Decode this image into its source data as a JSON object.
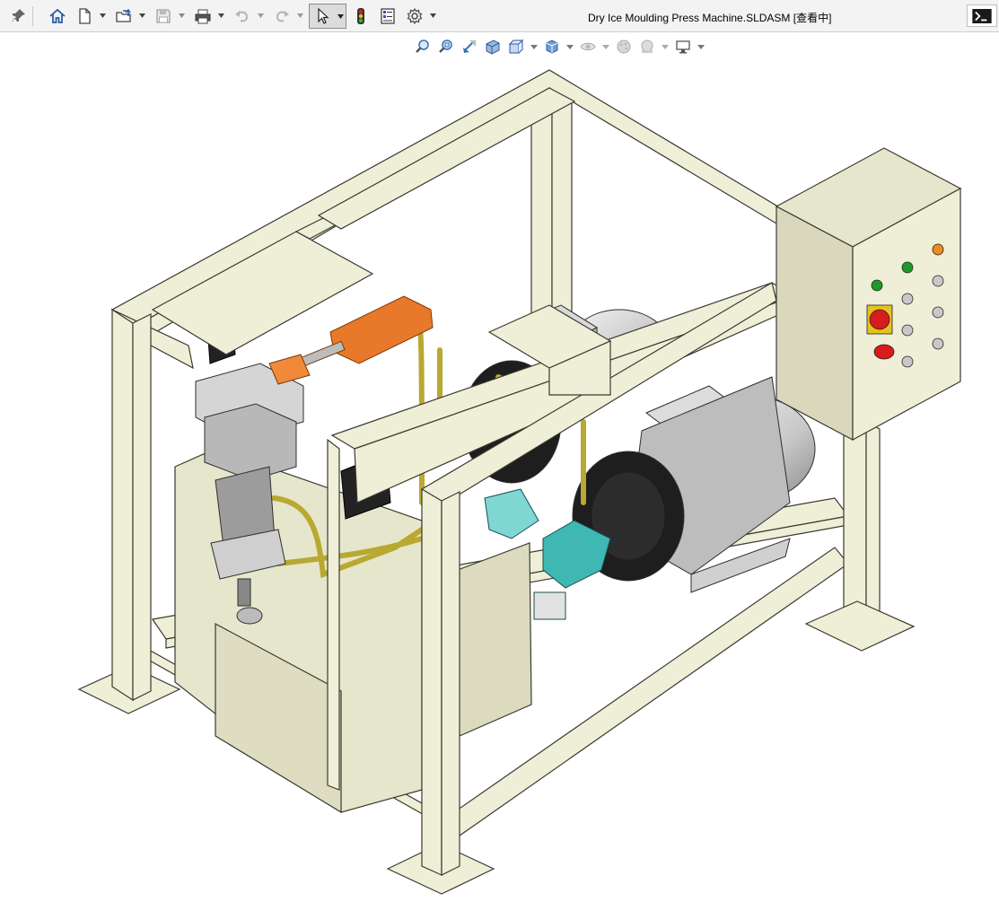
{
  "window": {
    "title": "Dry Ice Moulding Press Machine.SLDASM [查看中]"
  },
  "toolbar": {
    "buttons": [
      {
        "name": "pin-icon"
      },
      {
        "name": "home-icon"
      },
      {
        "name": "new-document-icon"
      },
      {
        "name": "open-folder-icon"
      },
      {
        "name": "save-icon"
      },
      {
        "name": "print-icon"
      },
      {
        "name": "undo-icon"
      },
      {
        "name": "redo-icon"
      },
      {
        "name": "select-cursor-icon"
      },
      {
        "name": "rebuild-traffic-light-icon"
      },
      {
        "name": "file-properties-icon"
      },
      {
        "name": "options-gear-icon"
      }
    ],
    "command_prompt_icon": "terminal-icon"
  },
  "view_toolbar": {
    "tools": [
      {
        "name": "zoom-to-fit-icon"
      },
      {
        "name": "zoom-to-area-icon"
      },
      {
        "name": "previous-view-icon"
      },
      {
        "name": "section-view-icon"
      },
      {
        "name": "view-orientation-icon"
      },
      {
        "name": "display-style-icon"
      },
      {
        "name": "hide-show-items-icon"
      },
      {
        "name": "edit-appearance-icon"
      },
      {
        "name": "apply-scene-icon"
      },
      {
        "name": "view-settings-icon"
      }
    ]
  },
  "model": {
    "frame_color": "#efefd8",
    "frame_edge_color": "#3a3a30",
    "motor_color": "#d6d6d6",
    "orange_part_color": "#e8792a",
    "pipe_color": "#b9a832",
    "cyan_part_color": "#3fb7b3",
    "button_red": "#d81b1b",
    "button_green": "#1e9a2a",
    "button_orange": "#f08a1c"
  }
}
